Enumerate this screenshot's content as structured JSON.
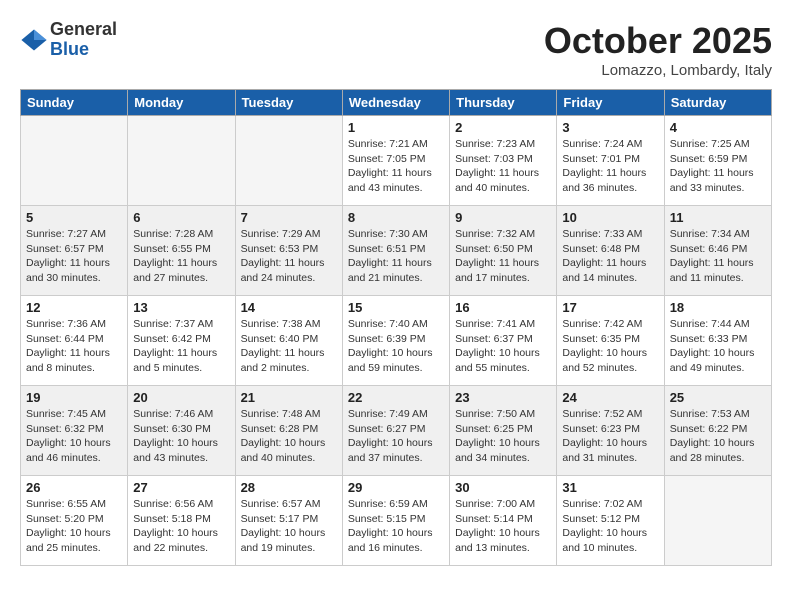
{
  "logo": {
    "general": "General",
    "blue": "Blue"
  },
  "title": "October 2025",
  "location": "Lomazzo, Lombardy, Italy",
  "days_of_week": [
    "Sunday",
    "Monday",
    "Tuesday",
    "Wednesday",
    "Thursday",
    "Friday",
    "Saturday"
  ],
  "weeks": [
    [
      {
        "day": "",
        "info": ""
      },
      {
        "day": "",
        "info": ""
      },
      {
        "day": "",
        "info": ""
      },
      {
        "day": "1",
        "info": "Sunrise: 7:21 AM\nSunset: 7:05 PM\nDaylight: 11 hours\nand 43 minutes."
      },
      {
        "day": "2",
        "info": "Sunrise: 7:23 AM\nSunset: 7:03 PM\nDaylight: 11 hours\nand 40 minutes."
      },
      {
        "day": "3",
        "info": "Sunrise: 7:24 AM\nSunset: 7:01 PM\nDaylight: 11 hours\nand 36 minutes."
      },
      {
        "day": "4",
        "info": "Sunrise: 7:25 AM\nSunset: 6:59 PM\nDaylight: 11 hours\nand 33 minutes."
      }
    ],
    [
      {
        "day": "5",
        "info": "Sunrise: 7:27 AM\nSunset: 6:57 PM\nDaylight: 11 hours\nand 30 minutes."
      },
      {
        "day": "6",
        "info": "Sunrise: 7:28 AM\nSunset: 6:55 PM\nDaylight: 11 hours\nand 27 minutes."
      },
      {
        "day": "7",
        "info": "Sunrise: 7:29 AM\nSunset: 6:53 PM\nDaylight: 11 hours\nand 24 minutes."
      },
      {
        "day": "8",
        "info": "Sunrise: 7:30 AM\nSunset: 6:51 PM\nDaylight: 11 hours\nand 21 minutes."
      },
      {
        "day": "9",
        "info": "Sunrise: 7:32 AM\nSunset: 6:50 PM\nDaylight: 11 hours\nand 17 minutes."
      },
      {
        "day": "10",
        "info": "Sunrise: 7:33 AM\nSunset: 6:48 PM\nDaylight: 11 hours\nand 14 minutes."
      },
      {
        "day": "11",
        "info": "Sunrise: 7:34 AM\nSunset: 6:46 PM\nDaylight: 11 hours\nand 11 minutes."
      }
    ],
    [
      {
        "day": "12",
        "info": "Sunrise: 7:36 AM\nSunset: 6:44 PM\nDaylight: 11 hours\nand 8 minutes."
      },
      {
        "day": "13",
        "info": "Sunrise: 7:37 AM\nSunset: 6:42 PM\nDaylight: 11 hours\nand 5 minutes."
      },
      {
        "day": "14",
        "info": "Sunrise: 7:38 AM\nSunset: 6:40 PM\nDaylight: 11 hours\nand 2 minutes."
      },
      {
        "day": "15",
        "info": "Sunrise: 7:40 AM\nSunset: 6:39 PM\nDaylight: 10 hours\nand 59 minutes."
      },
      {
        "day": "16",
        "info": "Sunrise: 7:41 AM\nSunset: 6:37 PM\nDaylight: 10 hours\nand 55 minutes."
      },
      {
        "day": "17",
        "info": "Sunrise: 7:42 AM\nSunset: 6:35 PM\nDaylight: 10 hours\nand 52 minutes."
      },
      {
        "day": "18",
        "info": "Sunrise: 7:44 AM\nSunset: 6:33 PM\nDaylight: 10 hours\nand 49 minutes."
      }
    ],
    [
      {
        "day": "19",
        "info": "Sunrise: 7:45 AM\nSunset: 6:32 PM\nDaylight: 10 hours\nand 46 minutes."
      },
      {
        "day": "20",
        "info": "Sunrise: 7:46 AM\nSunset: 6:30 PM\nDaylight: 10 hours\nand 43 minutes."
      },
      {
        "day": "21",
        "info": "Sunrise: 7:48 AM\nSunset: 6:28 PM\nDaylight: 10 hours\nand 40 minutes."
      },
      {
        "day": "22",
        "info": "Sunrise: 7:49 AM\nSunset: 6:27 PM\nDaylight: 10 hours\nand 37 minutes."
      },
      {
        "day": "23",
        "info": "Sunrise: 7:50 AM\nSunset: 6:25 PM\nDaylight: 10 hours\nand 34 minutes."
      },
      {
        "day": "24",
        "info": "Sunrise: 7:52 AM\nSunset: 6:23 PM\nDaylight: 10 hours\nand 31 minutes."
      },
      {
        "day": "25",
        "info": "Sunrise: 7:53 AM\nSunset: 6:22 PM\nDaylight: 10 hours\nand 28 minutes."
      }
    ],
    [
      {
        "day": "26",
        "info": "Sunrise: 6:55 AM\nSunset: 5:20 PM\nDaylight: 10 hours\nand 25 minutes."
      },
      {
        "day": "27",
        "info": "Sunrise: 6:56 AM\nSunset: 5:18 PM\nDaylight: 10 hours\nand 22 minutes."
      },
      {
        "day": "28",
        "info": "Sunrise: 6:57 AM\nSunset: 5:17 PM\nDaylight: 10 hours\nand 19 minutes."
      },
      {
        "day": "29",
        "info": "Sunrise: 6:59 AM\nSunset: 5:15 PM\nDaylight: 10 hours\nand 16 minutes."
      },
      {
        "day": "30",
        "info": "Sunrise: 7:00 AM\nSunset: 5:14 PM\nDaylight: 10 hours\nand 13 minutes."
      },
      {
        "day": "31",
        "info": "Sunrise: 7:02 AM\nSunset: 5:12 PM\nDaylight: 10 hours\nand 10 minutes."
      },
      {
        "day": "",
        "info": ""
      }
    ]
  ]
}
